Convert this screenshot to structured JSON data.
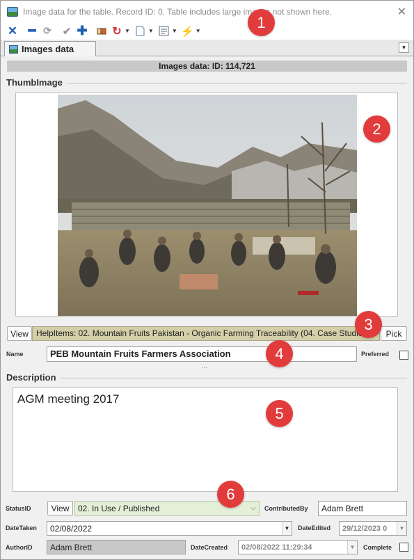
{
  "window": {
    "title": "Image data for the  table. Record ID: 0. Table includes large images not shown here.",
    "close_icon": "close-icon"
  },
  "toolbar": {
    "icons": [
      "cancel-icon",
      "remove-icon",
      "redo-icon",
      "check-icon",
      "add-icon",
      "eraser-icon",
      "refresh-icon",
      "document-icon",
      "form-icon",
      "lightning-icon"
    ]
  },
  "tab": {
    "label": "Images data"
  },
  "header": {
    "id_text": "Images data: ID: 114,721"
  },
  "thumb": {
    "label": "ThumbImage"
  },
  "help": {
    "view_label": "View",
    "value": "HelpItems: 02. Mountain Fruits Pakistan - Organic Farming Traceability (04. Case Studies)",
    "pick_label": "Pick"
  },
  "name": {
    "label": "Name",
    "value": "PEB Mountain Fruits Farmers Association",
    "preferred_label": "Preferred"
  },
  "description": {
    "label": "Description",
    "value": "AGM meeting 2017"
  },
  "status": {
    "label": "StatusID",
    "view_label": "View",
    "value": "02. In Use / Published",
    "contributed_label": "ContributedBy",
    "contributed_value": "Adam Brett"
  },
  "dates": {
    "taken_label": "DateTaken",
    "taken_value": "02/08/2022",
    "edited_label": "DateEdited",
    "edited_value": "29/12/2023 0"
  },
  "author": {
    "label": "AuthorID",
    "value": "Adam Brett",
    "created_label": "DateCreated",
    "created_value": "02/08/2022 11:29:34",
    "complete_label": "Complete"
  },
  "annotations": [
    "1",
    "2",
    "3",
    "4",
    "5",
    "6"
  ],
  "colors": {
    "help_bg": "#d4cfa9",
    "status_bg": "#e4efd8",
    "badge": "#e23b3b"
  }
}
